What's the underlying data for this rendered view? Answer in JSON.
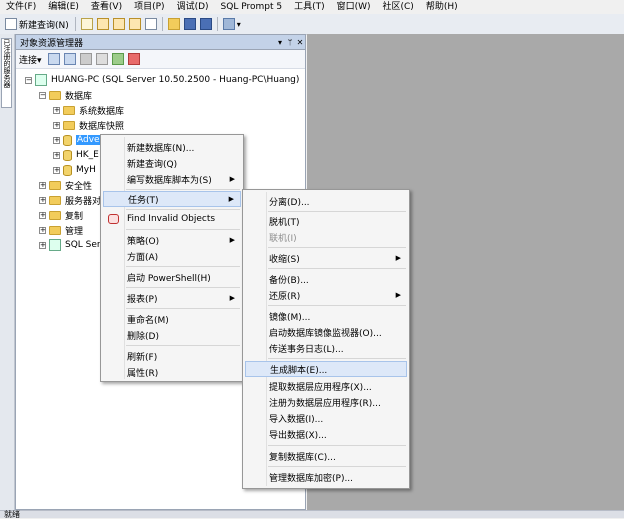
{
  "menubar": [
    "文件(F)",
    "编辑(E)",
    "查看(V)",
    "项目(P)",
    "调试(D)",
    "SQL Prompt 5",
    "工具(T)",
    "窗口(W)",
    "社区(C)",
    "帮助(H)"
  ],
  "toolbar": {
    "new_query": "新建查询(N)"
  },
  "sidestrip": {
    "tab_label": "已注册的服务器"
  },
  "panel": {
    "title": "对象资源管理器",
    "pin": "▾ ♯ ✕",
    "connect": "连接▾"
  },
  "tree": {
    "server": "HUANG-PC (SQL Server 10.50.2500 - Huang-PC\\Huang)",
    "databases": "数据库",
    "system_db": "系统数据库",
    "snapshots": "数据库快照",
    "db1": "Adve",
    "db2": "HK_E",
    "db3": "MyH",
    "security": "安全性",
    "server_objects": "服务器对",
    "replication": "复制",
    "management": "管理",
    "agent": "SQL Ser"
  },
  "context_menu": {
    "items": [
      "新建数据库(N)...",
      "新建查询(Q)",
      "编写数据库脚本为(S)",
      "任务(T)",
      "Find Invalid Objects",
      "策略(O)",
      "方面(A)",
      "启动 PowerShell(H)",
      "报表(P)",
      "重命名(M)",
      "删除(D)",
      "刷新(F)",
      "属性(R)"
    ]
  },
  "task_menu": {
    "items": [
      "分离(D)...",
      "脱机(T)",
      "联机(I)",
      "收缩(S)",
      "备份(B)...",
      "还原(R)",
      "镜像(M)...",
      "启动数据库镜像监视器(O)...",
      "传送事务日志(L)...",
      "生成脚本(E)...",
      "提取数据层应用程序(X)...",
      "注册为数据层应用程序(R)...",
      "导入数据(I)...",
      "导出数据(X)...",
      "复制数据库(C)...",
      "管理数据库加密(P)..."
    ]
  },
  "status": "就绪",
  "colors": {
    "selection": "#3399ff",
    "highlight": "#dde8f8",
    "panel_title": "#c3d2e8"
  }
}
